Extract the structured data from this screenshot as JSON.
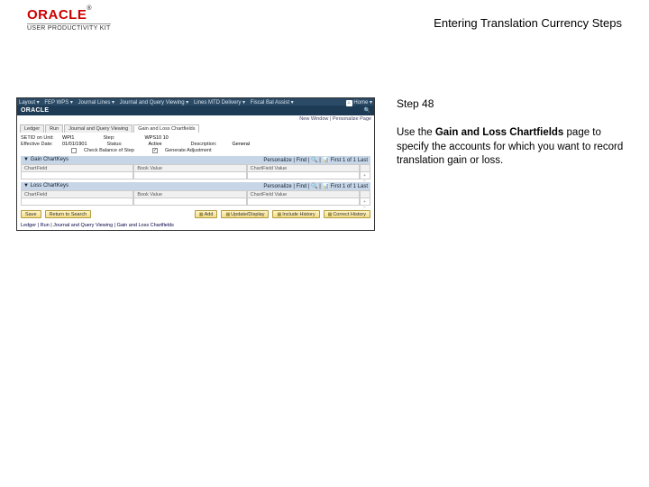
{
  "header": {
    "logo_text": "ORACLE",
    "logo_sub": "USER PRODUCTIVITY KIT",
    "doc_title": "Entering Translation Currency Steps"
  },
  "right": {
    "step_label": "Step 48",
    "instr_pre": "Use the ",
    "instr_bold": "Gain and Loss Chartfields",
    "instr_post": " page to specify the accounts for which you want to record translation gain or loss."
  },
  "shot": {
    "topnav": {
      "items": [
        "Layout ▾",
        "FEP WPS ▾",
        "Journal Lines ▾",
        "Journal and Query Viewing ▾",
        "Lines MTD Delivery ▾",
        "Fiscal Bal Assist ▾"
      ],
      "home": "Home ▾"
    },
    "appband": {
      "brand": "ORACLE",
      "right": "🔍"
    },
    "pageinfo": "New Window | Personalize Page",
    "tabs": [
      "Ledger",
      "Run",
      "Journal and Query Viewing",
      "Gain and Loss Chartfields"
    ],
    "active_tab": 3,
    "fields": {
      "set_id": {
        "label": "SETID on Unit:",
        "value": "WPI1"
      },
      "step": {
        "label": "Step:",
        "value": "WPS10  10"
      },
      "eff_date": {
        "label": "Effective Date:",
        "value": "01/01/1901"
      },
      "status_lbl": "Status:",
      "status_val": "Active",
      "desc_lbl": "Description:",
      "desc_val": "General",
      "check1": "Check Balance of Step",
      "check2": "Generate Adjustment"
    },
    "panel1": {
      "title": "▼ Gain ChartKeys",
      "toolbar": "Personalize | Find | 🔍 | 📊   First   1 of 1   Last"
    },
    "panel2": {
      "title": "▼ Loss ChartKeys",
      "toolbar": "Personalize | Find | 🔍 | 📊   First   1 of 1   Last"
    },
    "grid_headers": [
      "ChartField",
      "Book Value",
      "ChartField Value",
      ""
    ],
    "grid_row_icon1": "+",
    "grid_row_icon2": "−",
    "grid_row1": [
      "",
      "",
      ""
    ],
    "buttons": {
      "save": "Save",
      "return": "Return to Search",
      "add": "Add",
      "update": "Update/Display",
      "history": "Include History",
      "correct": "Correct History"
    },
    "breadcrumb": "Ledger | Run | Journal and Query Viewing | Gain and Loss Chartfields"
  }
}
